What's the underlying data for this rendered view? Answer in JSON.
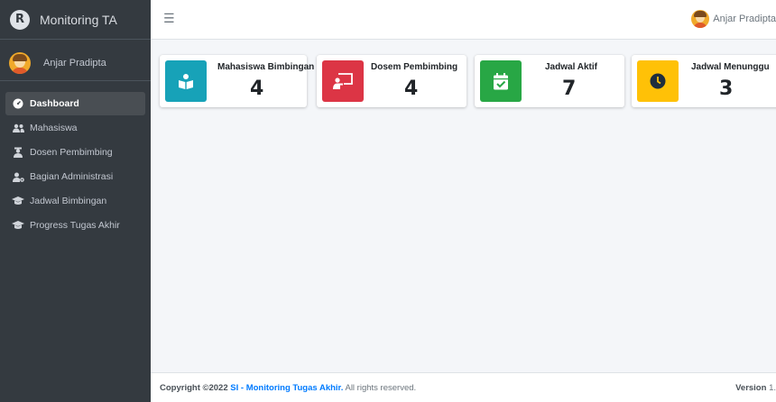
{
  "brand": {
    "name": "Monitoring TA",
    "logo_letter": "R"
  },
  "user": {
    "name": "Anjar Pradipta"
  },
  "sidebar": {
    "items": [
      {
        "label": "Dashboard",
        "icon": "dashboard-icon",
        "active": true
      },
      {
        "label": "Mahasiswa",
        "icon": "users-icon"
      },
      {
        "label": "Dosen Pembimbing",
        "icon": "teacher-icon"
      },
      {
        "label": "Bagian Administrasi",
        "icon": "user-cog-icon"
      },
      {
        "label": "Jadwal Bimbingan",
        "icon": "graduation-cap-icon"
      },
      {
        "label": "Progress Tugas Akhir",
        "icon": "graduation-cap-icon"
      }
    ]
  },
  "topbar": {
    "menu_icon": "hamburger-icon",
    "user_name": "Anjar Pradipta"
  },
  "cards": [
    {
      "title": "Mahasiswa Bimbingan",
      "value": "4",
      "color": "#17a2b8",
      "icon": "book-reader-icon"
    },
    {
      "title": "Dosem Pembimbing",
      "value": "4",
      "color": "#dc3545",
      "icon": "chalkboard-teacher-icon"
    },
    {
      "title": "Jadwal Aktif",
      "value": "7",
      "color": "#28a745",
      "icon": "calendar-check-icon"
    },
    {
      "title": "Jadwal Menunggu",
      "value": "3",
      "color": "#ffc107",
      "icon": "clock-icon"
    }
  ],
  "footer": {
    "copyright_prefix": "Copyright ©2022 ",
    "link_text": "SI - Monitoring Tugas Akhir.",
    "suffix": " All rights reserved.",
    "version_label": "Version",
    "version_value": "1."
  }
}
